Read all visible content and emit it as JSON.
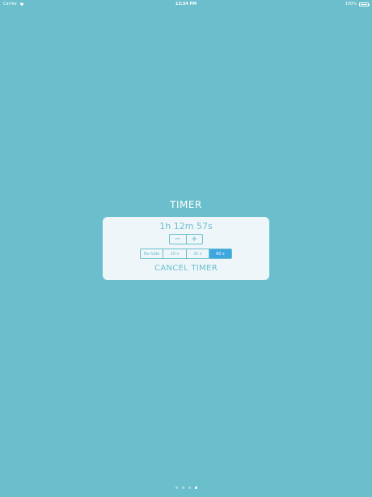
{
  "status_bar": {
    "carrier": "Carrier",
    "wifi_icon": "wifi-icon",
    "time": "12:34 PM",
    "battery": "100%",
    "battery_icon": "battery-icon"
  },
  "timer": {
    "title": "TIMER",
    "remaining": "1h 12m 57s",
    "decrement_label": "−",
    "increment_label": "+",
    "fade_options": [
      {
        "label": "No fade",
        "selected": false
      },
      {
        "label": "10 s",
        "selected": false
      },
      {
        "label": "30 s",
        "selected": false
      },
      {
        "label": "60 s",
        "selected": true
      }
    ],
    "cancel_label": "CANCEL TIMER"
  },
  "pagination": {
    "count": 4,
    "active_index": 3
  },
  "colors": {
    "background": "#6bbfcd",
    "card": "#eef6fa",
    "accent": "#6bbfcd",
    "selected": "#3fa7e0"
  }
}
